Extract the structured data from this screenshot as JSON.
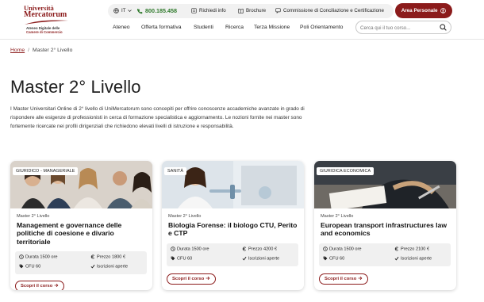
{
  "header": {
    "logo": {
      "line1": "Università",
      "line2": "Mercatorum",
      "line3": "Ateneo Digitale delle",
      "line4": "Camere di Commercio"
    },
    "topbar": {
      "language": "IT",
      "phone": "800.185.458",
      "info_label": "Richiedi info",
      "brochure_label": "Brochure",
      "commission_label": "Commissione di Conciliazione e Certificazione"
    },
    "area_button_label": "Area Personale",
    "nav": [
      "Ateneo",
      "Offerta formativa",
      "Studenti",
      "Ricerca",
      "Terza Missione",
      "Poli Orientamento"
    ],
    "search_placeholder": "Cerca qui il tuo corso..."
  },
  "breadcrumb": {
    "home": "Home",
    "separator": "/",
    "current": "Master 2° Livello"
  },
  "page_title": "Master 2° Livello",
  "intro": "I Master Universitari Online di 2° livello di UniMercatorum sono concepiti per offrire conoscenze accademiche avanzate in grado di rispondere alle esigenze di professionisti in cerca di formazione specialistica e aggiornamento. Le nozioni fornite nei master sono fortemente ricercate nei profili dirigenziali che richiedono elevati livelli di istruzione e responsabilità.",
  "cards": [
    {
      "tag": "GIURIDICO - MANAGERIALE",
      "level": "Master 2° Livello",
      "title": "Management e governance delle politiche di coesione e divario territoriale",
      "duration": "Durata 1500 ore",
      "price": "Prezzo 1800 €",
      "cfu": "CFU 60",
      "status": "Iscrizioni aperte",
      "button": "Scopri il corso"
    },
    {
      "tag": "SANITÀ",
      "level": "Master 2° Livello",
      "title": "Biologia Forense: il biologo CTU, Perito e CTP",
      "duration": "Durata 1500 ore",
      "price": "Prezzo 4200 €",
      "cfu": "CFU 60",
      "status": "Iscrizioni aperte",
      "button": "Scopri il corso"
    },
    {
      "tag": "GIURIDICA ECONOMICA",
      "level": "Master 2° Livello",
      "title": "European transport infrastructures law and economics",
      "duration": "Durata 1500 ore",
      "price": "Prezzo 2100 €",
      "cfu": "CFU 60",
      "status": "Iscrizioni aperte",
      "button": "Scopri il corso"
    }
  ],
  "colors": {
    "brand": "#8b1b1b",
    "phone": "#2f7a2c",
    "topbar_bg": "#f1f1f1",
    "meta_bg": "#f0f0f0"
  },
  "icons": [
    "globe-icon",
    "phone-icon",
    "document-icon",
    "brochure-icon",
    "chat-icon",
    "user-icon",
    "search-icon",
    "clock-icon",
    "euro-icon",
    "tag-icon",
    "check-icon",
    "arrow-right-icon"
  ]
}
